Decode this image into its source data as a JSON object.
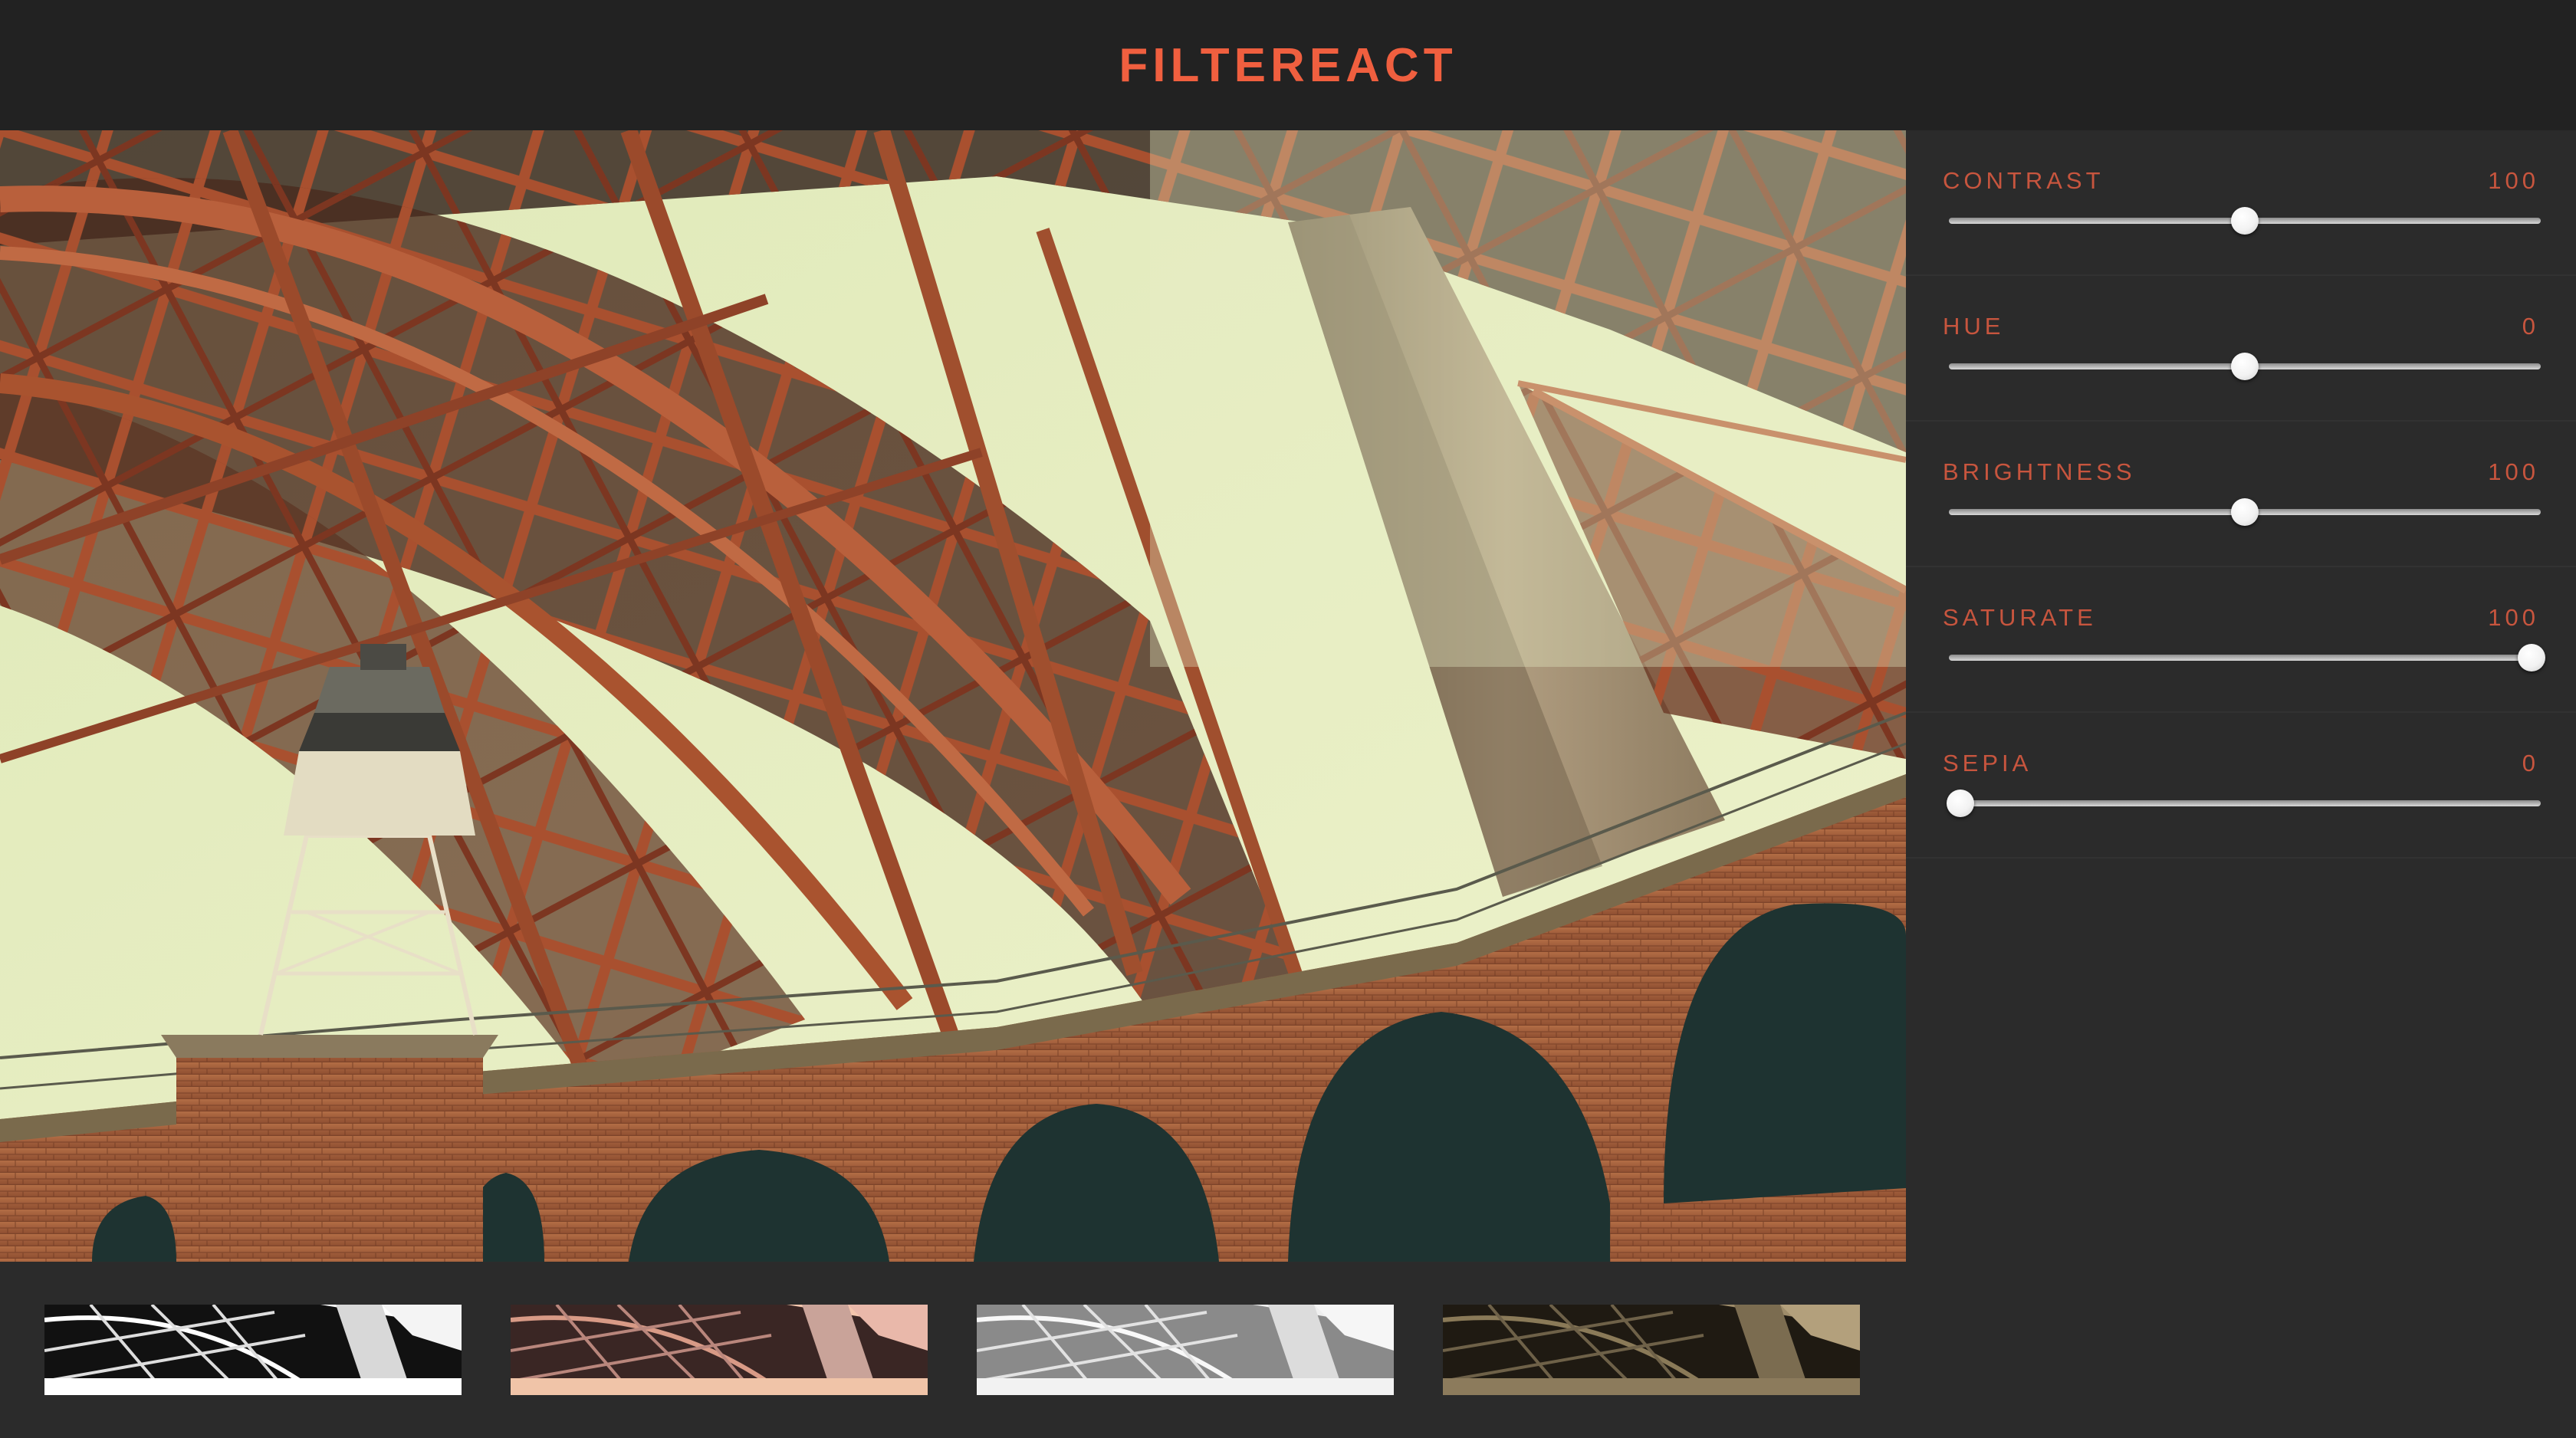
{
  "app": {
    "title": "FILTEREACT"
  },
  "image": {
    "subject": "Golden Gate Bridge steel arch over Fort Point brick arches with lighthouse",
    "colors": {
      "sky": "#e6efc0",
      "steel": "#b5573a",
      "steel_dark": "#6f2e1c",
      "brick": "#a5633f",
      "brick_shadow": "#1f3a38",
      "concrete": "#a89374"
    }
  },
  "filters": [
    {
      "label": "CONTRAST",
      "value": "100",
      "level": 0.5
    },
    {
      "label": "HUE",
      "value": "0",
      "level": 0.5
    },
    {
      "label": "BRIGHTNESS",
      "value": "100",
      "level": 0.5
    },
    {
      "label": "SATURATE",
      "value": "100",
      "level": 0.985
    },
    {
      "label": "SEPIA",
      "value": "0",
      "level": 0.02
    }
  ],
  "presets": [
    {
      "style": "grayscale-high-contrast",
      "tint": "#ffffff"
    },
    {
      "style": "warm-pink",
      "tint": "#f4c6ad"
    },
    {
      "style": "light-gray",
      "tint": "#ececec"
    },
    {
      "style": "sepia-dark",
      "tint": "#9e8c6a"
    }
  ],
  "theme": {
    "accent": "#f05f3f",
    "label_color": "#c7553e",
    "header_bg": "#222222",
    "panel_bg": "#2b2b2b"
  }
}
